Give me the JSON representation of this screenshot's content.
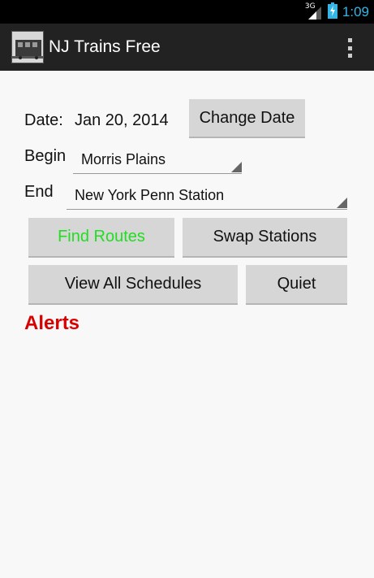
{
  "status_bar": {
    "network": "3G",
    "time": "1:09"
  },
  "action_bar": {
    "title": "NJ Trains Free"
  },
  "form": {
    "date_label": "Date:",
    "date_value": "Jan 20, 2014",
    "change_date_label": "Change Date",
    "begin_label": "Begin",
    "begin_value": "Morris Plains",
    "end_label": "End",
    "end_value": "New York Penn Station"
  },
  "buttons": {
    "find_routes": "Find Routes",
    "swap_stations": "Swap Stations",
    "view_all_schedules": "View All Schedules",
    "quiet": "Quiet"
  },
  "alerts": {
    "heading": "Alerts"
  },
  "colors": {
    "time_accent": "#33b5e5",
    "find_routes_text": "#22dd22",
    "alerts_text": "#d90000"
  }
}
